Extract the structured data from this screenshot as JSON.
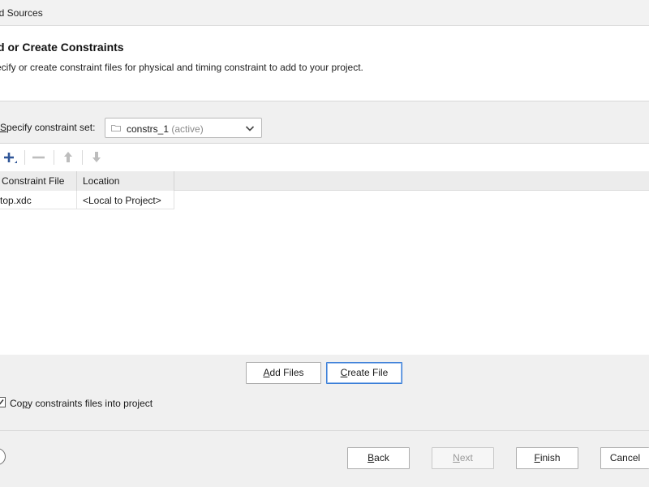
{
  "window": {
    "title": "dd Sources"
  },
  "header": {
    "title": "d or Create Constraints",
    "subtitle": "ecify or create constraint files for physical and timing constraint to add to your project."
  },
  "constraint_set": {
    "label_hotkey": "S",
    "label_rest": "pecify constraint set:",
    "value": "constrs_1",
    "value_suffix": "(active)"
  },
  "toolbar": {
    "add": "plus-icon",
    "remove": "minus-icon",
    "move_up": "arrow-up-icon",
    "move_down": "arrow-down-icon"
  },
  "table": {
    "columns": [
      "Constraint File",
      "Location"
    ],
    "rows": [
      {
        "file": "top.xdc",
        "location": "<Local to Project>"
      }
    ]
  },
  "file_buttons": {
    "add_files": {
      "hotkey": "A",
      "rest": "dd Files"
    },
    "create_file": {
      "hotkey": "C",
      "rest": "reate File"
    }
  },
  "copy_option": {
    "checked": true,
    "label_pre": "Co",
    "label_hotkey": "p",
    "label_post": "y constraints files into project"
  },
  "nav_buttons": {
    "back": {
      "hotkey": "B",
      "rest": "ack"
    },
    "next": {
      "hotkey": "N",
      "rest": "ext"
    },
    "finish": {
      "hotkey": "F",
      "rest": "inish"
    },
    "cancel": "Cancel"
  },
  "colors": {
    "accent": "#3c7fd8",
    "icon_blue": "#2f5597",
    "disabled": "#9a9a9a"
  }
}
